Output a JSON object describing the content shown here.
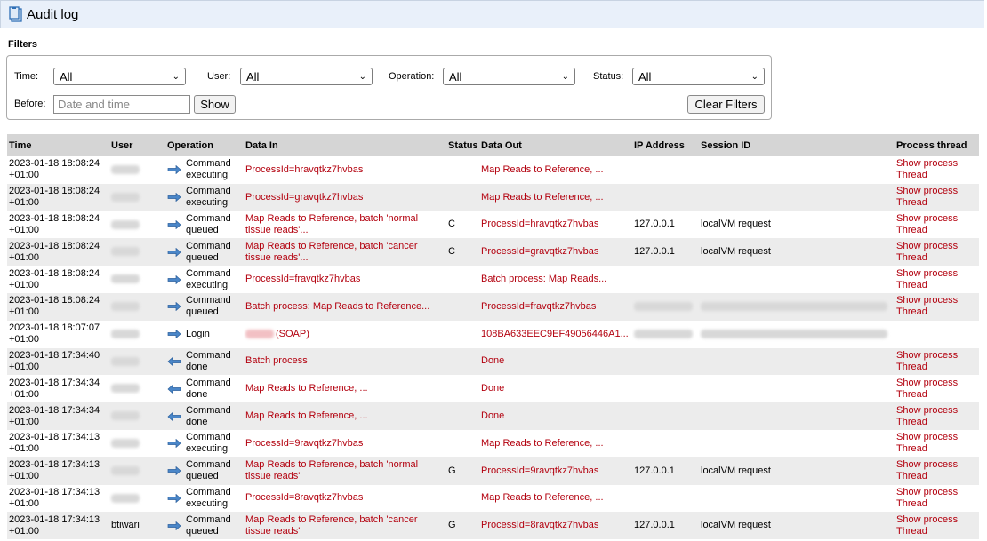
{
  "window": {
    "title": "Audit log",
    "icon": "clipboard-icon"
  },
  "filters": {
    "heading": "Filters",
    "time_label": "Time:",
    "time_value": "All",
    "user_label": "User:",
    "user_value": "All",
    "operation_label": "Operation:",
    "operation_value": "All",
    "status_label": "Status:",
    "status_value": "All",
    "before_label": "Before:",
    "before_placeholder": "Date and time",
    "show_button": "Show",
    "clear_button": "Clear Filters"
  },
  "table": {
    "headers": [
      "Time",
      "User",
      "Operation",
      "Data In",
      "Status",
      "Data Out",
      "IP Address",
      "Session ID",
      "Process thread"
    ],
    "rows": [
      {
        "time": "2023-01-18 18:08:24 +01:00",
        "user": "",
        "user_blurred": true,
        "dir": "right",
        "op": "Command executing",
        "data_in": "ProcessId=hravqtkz7hvbas",
        "status": "",
        "data_out": "Map Reads to Reference, ...",
        "ip": "",
        "ip_blurred": false,
        "session": "",
        "session_blurred": false,
        "thread": "Show process Thread"
      },
      {
        "time": "2023-01-18 18:08:24 +01:00",
        "user": "",
        "user_blurred": true,
        "dir": "right",
        "op": "Command executing",
        "data_in": "ProcessId=gravqtkz7hvbas",
        "status": "",
        "data_out": "Map Reads to Reference, ...",
        "ip": "",
        "ip_blurred": false,
        "session": "",
        "session_blurred": false,
        "thread": "Show process Thread"
      },
      {
        "time": "2023-01-18 18:08:24 +01:00",
        "user": "",
        "user_blurred": true,
        "dir": "right",
        "op": "Command queued",
        "data_in": "Map Reads to Reference, batch 'normal tissue reads'...",
        "status": "C",
        "data_out": "ProcessId=hravqtkz7hvbas",
        "ip": "127.0.0.1",
        "ip_blurred": false,
        "session": "localVM request",
        "session_blurred": false,
        "thread": "Show process Thread"
      },
      {
        "time": "2023-01-18 18:08:24 +01:00",
        "user": "",
        "user_blurred": true,
        "dir": "right",
        "op": "Command queued",
        "data_in": "Map Reads to Reference, batch 'cancer tissue reads'...",
        "status": "C",
        "data_out": "ProcessId=gravqtkz7hvbas",
        "ip": "127.0.0.1",
        "ip_blurred": false,
        "session": "localVM request",
        "session_blurred": false,
        "thread": "Show process Thread"
      },
      {
        "time": "2023-01-18 18:08:24 +01:00",
        "user": "",
        "user_blurred": true,
        "dir": "right",
        "op": "Command executing",
        "data_in": "ProcessId=fravqtkz7hvbas",
        "status": "",
        "data_out": "Batch process: Map Reads...",
        "ip": "",
        "ip_blurred": false,
        "session": "",
        "session_blurred": false,
        "thread": "Show process Thread"
      },
      {
        "time": "2023-01-18 18:08:24 +01:00",
        "user": "",
        "user_blurred": true,
        "dir": "right",
        "op": "Command queued",
        "data_in": "Batch process: Map Reads to Reference...",
        "status": "",
        "data_out": "ProcessId=fravqtkz7hvbas",
        "ip": "",
        "ip_blurred": true,
        "session": "",
        "session_blurred": true,
        "thread": "Show process Thread"
      },
      {
        "time": "2023-01-18 18:07:07 +01:00",
        "user": "",
        "user_blurred": true,
        "dir": "right",
        "op": "Login",
        "data_in": "(SOAP)",
        "data_in_blur_prefix": true,
        "status": "",
        "data_out": "108BA633EEC9EF49056446A1...",
        "ip": "",
        "ip_blurred": true,
        "session": "",
        "session_blurred": true,
        "thread": ""
      },
      {
        "time": "2023-01-18 17:34:40 +01:00",
        "user": "",
        "user_blurred": true,
        "dir": "left",
        "op": "Command done",
        "data_in": "Batch process",
        "status": "",
        "data_out": "Done",
        "ip": "",
        "ip_blurred": false,
        "session": "",
        "session_blurred": false,
        "thread": "Show process Thread"
      },
      {
        "time": "2023-01-18 17:34:34 +01:00",
        "user": "",
        "user_blurred": true,
        "dir": "left",
        "op": "Command done",
        "data_in": "Map Reads to Reference, ...",
        "status": "",
        "data_out": "Done",
        "ip": "",
        "ip_blurred": false,
        "session": "",
        "session_blurred": false,
        "thread": "Show process Thread"
      },
      {
        "time": "2023-01-18 17:34:34 +01:00",
        "user": "",
        "user_blurred": true,
        "dir": "left",
        "op": "Command done",
        "data_in": "Map Reads to Reference, ...",
        "status": "",
        "data_out": "Done",
        "ip": "",
        "ip_blurred": false,
        "session": "",
        "session_blurred": false,
        "thread": "Show process Thread"
      },
      {
        "time": "2023-01-18 17:34:13 +01:00",
        "user": "",
        "user_blurred": true,
        "dir": "right",
        "op": "Command executing",
        "data_in": "ProcessId=9ravqtkz7hvbas",
        "status": "",
        "data_out": "Map Reads to Reference, ...",
        "ip": "",
        "ip_blurred": false,
        "session": "",
        "session_blurred": false,
        "thread": "Show process Thread"
      },
      {
        "time": "2023-01-18 17:34:13 +01:00",
        "user": "",
        "user_blurred": true,
        "dir": "right",
        "op": "Command queued",
        "data_in": "Map Reads to Reference, batch 'normal tissue reads'",
        "status": "G",
        "data_out": "ProcessId=9ravqtkz7hvbas",
        "ip": "127.0.0.1",
        "ip_blurred": false,
        "session": "localVM request",
        "session_blurred": false,
        "thread": "Show process Thread"
      },
      {
        "time": "2023-01-18 17:34:13 +01:00",
        "user": "",
        "user_blurred": true,
        "dir": "right",
        "op": "Command executing",
        "data_in": "ProcessId=8ravqtkz7hvbas",
        "status": "",
        "data_out": "Map Reads to Reference, ...",
        "ip": "",
        "ip_blurred": false,
        "session": "",
        "session_blurred": false,
        "thread": "Show process Thread"
      },
      {
        "time": "2023-01-18 17:34:13 +01:00",
        "user": "btiwari",
        "user_blurred": false,
        "dir": "right",
        "op": "Command queued",
        "data_in": "Map Reads to Reference, batch 'cancer tissue reads'",
        "status": "G",
        "data_out": "ProcessId=8ravqtkz7hvbas",
        "ip": "127.0.0.1",
        "ip_blurred": false,
        "session": "localVM request",
        "session_blurred": false,
        "thread": "Show process Thread"
      }
    ]
  }
}
